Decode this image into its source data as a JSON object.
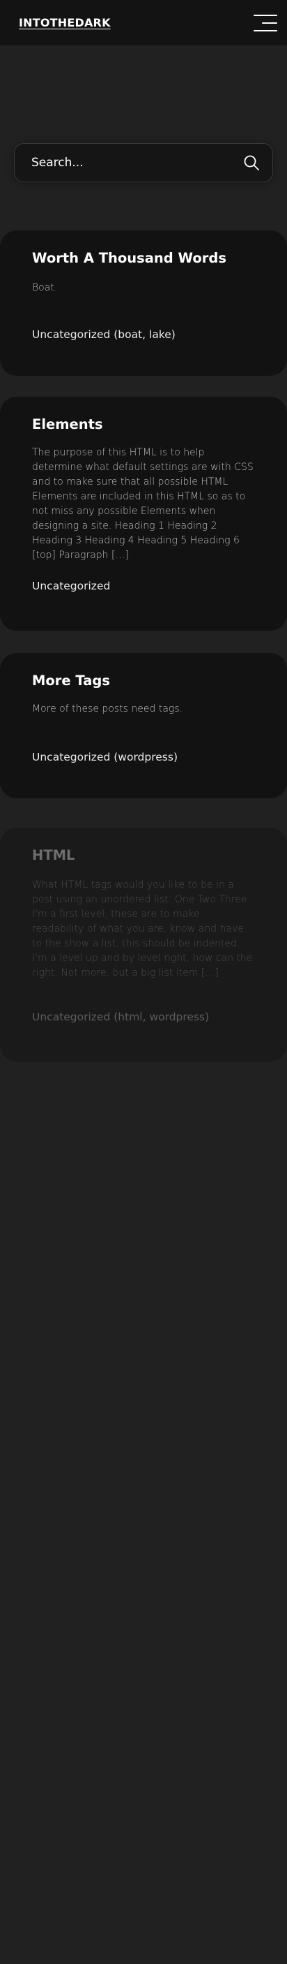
{
  "header": {
    "site_title": "INTOTHEDARK"
  },
  "search": {
    "placeholder": "Search..."
  },
  "posts": [
    {
      "title": "Worth A Thousand Words",
      "excerpt": "Boat.",
      "meta": "Uncategorized (boat, lake)"
    },
    {
      "title": "Elements",
      "excerpt": "The purpose of this HTML is to help determine what default settings are with CSS and to make sure that all possible HTML Elements are included in this HTML so as to not miss any possible Elements when designing a site. Heading 1 Heading 2 Heading 3 Heading 4 Heading 5 Heading 6 [top] Paragraph […]",
      "meta": "Uncategorized"
    },
    {
      "title": "More Tags",
      "excerpt": "More of these posts need tags.",
      "meta": "Uncategorized (wordpress)"
    },
    {
      "title": "HTML",
      "excerpt": "What HTML tags would you like to be in a post using an unordered list: One Two Three I'm a first level, these are to make readability of what you are, know and have to the show a list, this should be indented. I'm a level up and by level right, how can the right, Not more, but a big list item […]",
      "meta": "Uncategorized (html, wordpress)"
    }
  ],
  "colors": {
    "page_bg": "#212121",
    "header_bg": "#131313",
    "card_bg": "#121212"
  }
}
